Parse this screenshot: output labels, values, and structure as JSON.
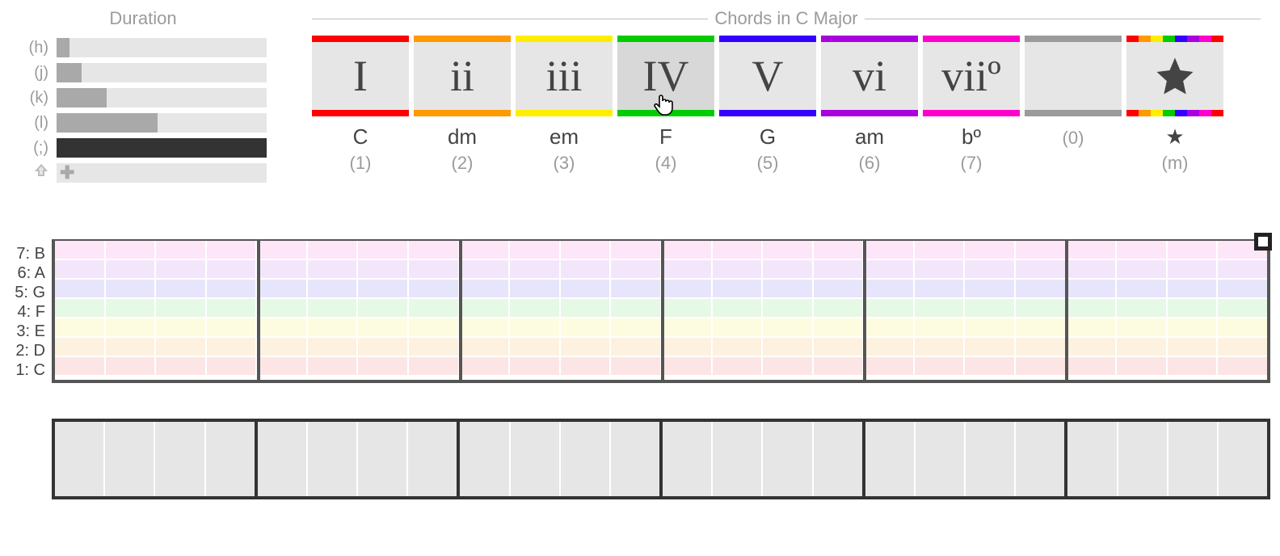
{
  "duration": {
    "title": "Duration",
    "rows": [
      {
        "key": "(h)",
        "fill_pct": 6,
        "selected": false
      },
      {
        "key": "(j)",
        "fill_pct": 12,
        "selected": false
      },
      {
        "key": "(k)",
        "fill_pct": 24,
        "selected": false
      },
      {
        "key": "(l)",
        "fill_pct": 48,
        "selected": false
      },
      {
        "key": "(;)",
        "fill_pct": 100,
        "selected": true
      },
      {
        "key": "shift",
        "fill_pct": 0,
        "selected": false,
        "is_plus": true
      }
    ]
  },
  "chords": {
    "title": "Chords in C Major",
    "items": [
      {
        "roman": "I",
        "name": "C",
        "key": "(1)",
        "color": "#ff0000"
      },
      {
        "roman": "ii",
        "name": "dm",
        "key": "(2)",
        "color": "#ff9900"
      },
      {
        "roman": "iii",
        "name": "em",
        "key": "(3)",
        "color": "#ffee00"
      },
      {
        "roman": "IV",
        "name": "F",
        "key": "(4)",
        "color": "#00cc00",
        "hovered": true
      },
      {
        "roman": "V",
        "name": "G",
        "key": "(5)",
        "color": "#3300ff"
      },
      {
        "roman": "vi",
        "name": "am",
        "key": "(6)",
        "color": "#aa00dd"
      },
      {
        "roman": "viiº",
        "name": "bº",
        "key": "(7)",
        "color": "#ff00cc"
      },
      {
        "roman": "",
        "name": "",
        "key": "(0)",
        "color": "#9b9b9b"
      },
      {
        "roman": "★",
        "name": "★",
        "key": "(m)",
        "rainbow": true
      }
    ],
    "rainbow_colors": [
      "#ff0000",
      "#ff9900",
      "#ffee00",
      "#00cc00",
      "#3300ff",
      "#aa00dd",
      "#ff00cc",
      "#ff0000"
    ]
  },
  "sequencer": {
    "note_rows": [
      {
        "label": "7: B",
        "color": "#fce6f7"
      },
      {
        "label": "6: A",
        "color": "#f3e6fb"
      },
      {
        "label": "5: G",
        "color": "#e7e5fb"
      },
      {
        "label": "4: F",
        "color": "#e6f8e6"
      },
      {
        "label": "3: E",
        "color": "#fdfce0"
      },
      {
        "label": "2: D",
        "color": "#fdf1df"
      },
      {
        "label": "1: C",
        "color": "#fde5e5"
      }
    ],
    "bars": 6,
    "subdivisions_per_bar": 4
  }
}
